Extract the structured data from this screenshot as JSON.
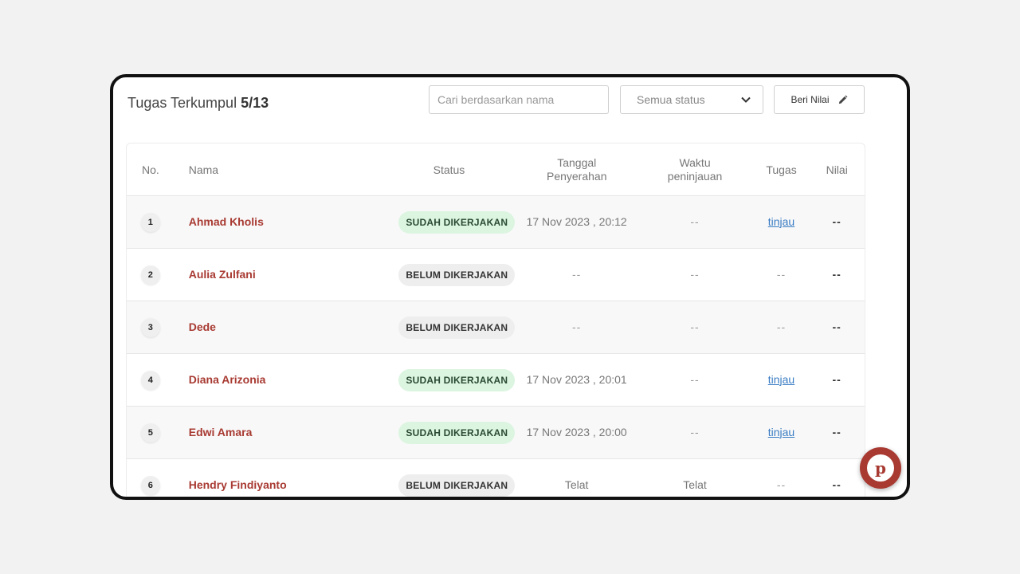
{
  "header": {
    "title": "Tugas Terkumpul",
    "count": "5/13",
    "search_placeholder": "Cari berdasarkan nama",
    "status_filter": "Semua status",
    "grade_button": "Beri Nilai"
  },
  "columns": {
    "no": "No.",
    "name": "Nama",
    "status": "Status",
    "date_line1": "Tanggal",
    "date_line2": "Penyerahan",
    "review_line1": "Waktu",
    "review_line2": "peninjauan",
    "task": "Tugas",
    "score": "Nilai"
  },
  "rows": [
    {
      "no": "1",
      "name": "Ahmad Kholis",
      "status": "SUDAH DIKERJAKAN",
      "date": "17 Nov 2023 , 20:12",
      "review": "--",
      "task": "tinjau",
      "score": "--"
    },
    {
      "no": "2",
      "name": "Aulia Zulfani",
      "status": "BELUM DIKERJAKAN",
      "date": "--",
      "review": "--",
      "task": "--",
      "score": "--"
    },
    {
      "no": "3",
      "name": "Dede",
      "status": "BELUM DIKERJAKAN",
      "date": "--",
      "review": "--",
      "task": "--",
      "score": "--"
    },
    {
      "no": "4",
      "name": "Diana Arizonia",
      "status": "SUDAH DIKERJAKAN",
      "date": "17 Nov 2023 , 20:01",
      "review": "--",
      "task": "tinjau",
      "score": "--"
    },
    {
      "no": "5",
      "name": "Edwi Amara",
      "status": "SUDAH DIKERJAKAN",
      "date": "17 Nov 2023 , 20:00",
      "review": "--",
      "task": "tinjau",
      "score": "--"
    },
    {
      "no": "6",
      "name": "Hendry Findiyanto",
      "status": "BELUM DIKERJAKAN",
      "date": "Telat",
      "review": "Telat",
      "task": "--",
      "score": "--"
    }
  ],
  "colors": {
    "accent": "#a83a32",
    "done_bg": "#dcf5e1",
    "link": "#3b7dc4"
  },
  "icons": {
    "dropdown": "chevron-down-icon",
    "grade": "pencil-icon",
    "fab": "chat-logo-icon"
  }
}
